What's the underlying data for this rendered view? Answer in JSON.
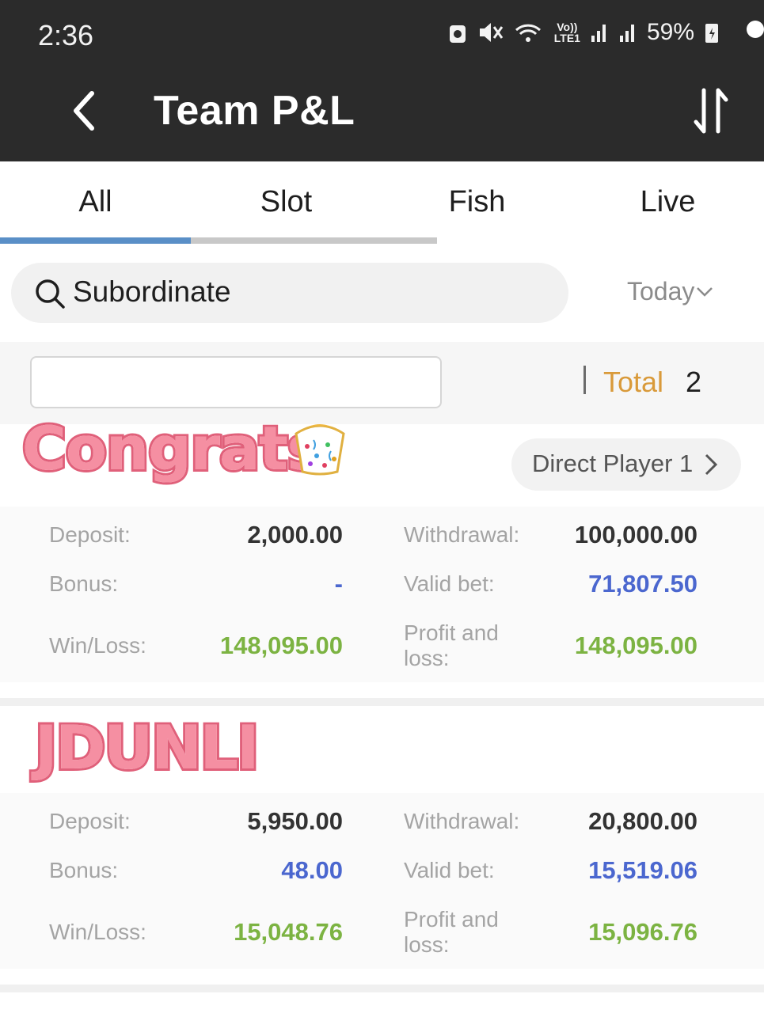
{
  "status_bar": {
    "time": "2:36",
    "net_label_top": "Vo))",
    "net_label_bottom": "LTE1",
    "battery": "59%"
  },
  "app_bar": {
    "title": "Team P&L"
  },
  "tabs": [
    {
      "label": "All",
      "selected": true
    },
    {
      "label": "Slot",
      "selected": false
    },
    {
      "label": "Fish",
      "selected": false
    },
    {
      "label": "Live",
      "selected": false
    }
  ],
  "search": {
    "placeholder": "Subordinate"
  },
  "date_filter": {
    "label": "Today"
  },
  "summary": {
    "total_label": "Total",
    "total_value": "2"
  },
  "stickers": {
    "congrats": "Congrats",
    "jdunli": "JDUNLI"
  },
  "direct_player": {
    "label": "Direct Player 1"
  },
  "records": [
    {
      "deposit_label": "Deposit:",
      "deposit": "2,000.00",
      "withdrawal_label": "Withdrawal:",
      "withdrawal": "100,000.00",
      "bonus_label": "Bonus:",
      "bonus": "-",
      "valid_bet_label": "Valid bet:",
      "valid_bet": "71,807.50",
      "win_loss_label": "Win/Loss:",
      "win_loss": "148,095.00",
      "profit_label_1": "Profit and",
      "profit_label_2": "loss:",
      "profit": "148,095.00"
    },
    {
      "deposit_label": "Deposit:",
      "deposit": "5,950.00",
      "withdrawal_label": "Withdrawal:",
      "withdrawal": "20,800.00",
      "bonus_label": "Bonus:",
      "bonus": "48.00",
      "valid_bet_label": "Valid bet:",
      "valid_bet": "15,519.06",
      "win_loss_label": "Win/Loss:",
      "win_loss": "15,048.76",
      "profit_label_1": "Profit and",
      "profit_label_2": "loss:",
      "profit": "15,096.76"
    }
  ],
  "colors": {
    "header_bg": "#2b2b2b",
    "tab_indicator": "#5a8fc7",
    "total_label": "#d99a3a",
    "value_blue": "#4b67cf",
    "value_green": "#7cb342"
  }
}
